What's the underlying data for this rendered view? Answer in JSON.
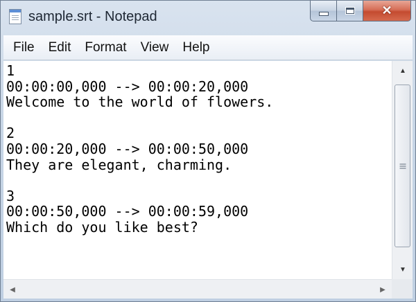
{
  "window": {
    "title": "sample.srt - Notepad",
    "close_glyph": "✕",
    "accent": "#c44b30"
  },
  "menu": {
    "items": [
      "File",
      "Edit",
      "Format",
      "View",
      "Help"
    ]
  },
  "editor": {
    "lines": [
      "1",
      "00:00:00,000 --> 00:00:20,000",
      "Welcome to the world of flowers.",
      "",
      "2",
      "00:00:20,000 --> 00:00:50,000",
      "They are elegant, charming.",
      "",
      "3",
      "00:00:50,000 --> 00:00:59,000",
      "Which do you like best?"
    ]
  },
  "scrollbar": {
    "up_arrow": "▲",
    "down_arrow": "▼",
    "left_arrow": "◀",
    "right_arrow": "▶"
  }
}
